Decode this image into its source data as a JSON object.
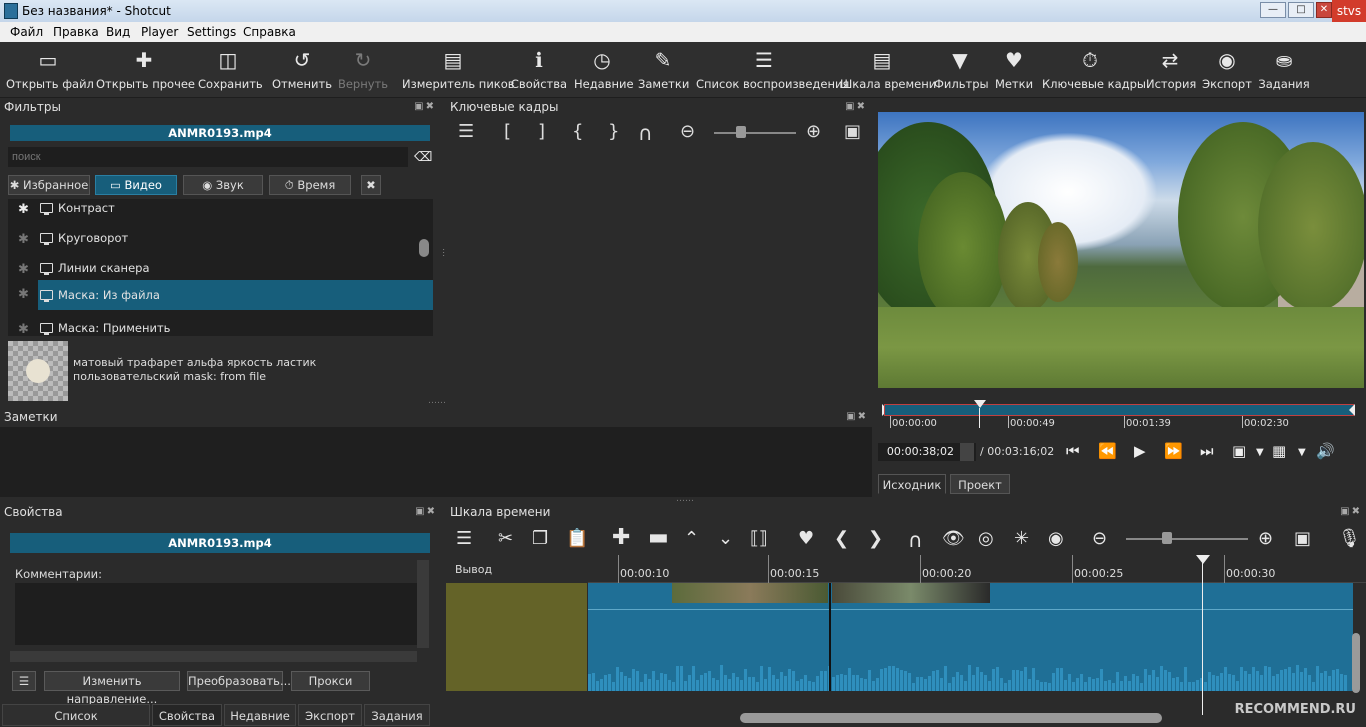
{
  "window": {
    "title": "Без названия* - Shotcut",
    "user_badge": "stvs"
  },
  "menu": [
    "Файл",
    "Правка",
    "Вид",
    "Player",
    "Settings",
    "Справка"
  ],
  "toolbar": [
    {
      "icon": "open-file-icon",
      "label": "Открыть файл"
    },
    {
      "icon": "open-other-icon",
      "label": "Открыть прочее"
    },
    {
      "icon": "save-icon",
      "label": "Сохранить"
    },
    {
      "icon": "undo-icon",
      "label": "Отменить"
    },
    {
      "icon": "redo-icon",
      "label": "Вернуть"
    },
    {
      "icon": "peak-meter-icon",
      "label": "Измеритель пиков"
    },
    {
      "icon": "properties-icon",
      "label": "Свойства"
    },
    {
      "icon": "recent-icon",
      "label": "Недавние"
    },
    {
      "icon": "notes-icon",
      "label": "Заметки"
    },
    {
      "icon": "playlist-icon",
      "label": "Список воспроизведения"
    },
    {
      "icon": "timeline-icon",
      "label": "Шкала времени"
    },
    {
      "icon": "filters-icon",
      "label": "Фильтры"
    },
    {
      "icon": "markers-icon",
      "label": "Метки"
    },
    {
      "icon": "keyframes-icon",
      "label": "Ключевые кадры"
    },
    {
      "icon": "history-icon",
      "label": "История"
    },
    {
      "icon": "export-icon",
      "label": "Экспорт"
    },
    {
      "icon": "jobs-icon",
      "label": "Задания"
    }
  ],
  "filters": {
    "title": "Фильтры",
    "file": "ANMR0193.mp4",
    "search_placeholder": "поиск",
    "tabs": [
      "Избранное",
      "Видео",
      "Звук",
      "Время"
    ],
    "items": [
      "Контраст",
      "Круговорот",
      "Линии сканера",
      "Маска: Из файла",
      "Маска: Применить"
    ],
    "description": "матовый трафарет альфа яркость ластик пользовательский mask: from file"
  },
  "keyframes": {
    "title": "Ключевые кадры"
  },
  "player": {
    "ticks": [
      "00:00:00",
      "00:00:49",
      "00:01:39",
      "00:02:30"
    ],
    "current": "00:00:38;02",
    "total": "/ 00:03:16;02",
    "tabs": [
      "Исходник",
      "Проект"
    ]
  },
  "notes": {
    "title": "Заметки"
  },
  "properties": {
    "title": "Свойства",
    "file": "ANMR0193.mp4",
    "comments_label": "Комментарии:",
    "buttons": [
      "Изменить направление...",
      "Преобразовать...",
      "Прокси"
    ]
  },
  "bottom_tabs": [
    "Список воспроизведения",
    "Свойства",
    "Недавние",
    "Экспорт",
    "Задания"
  ],
  "timeline": {
    "title": "Шкала времени",
    "track": "Вывод",
    "ticks": [
      "00:00:10",
      "00:00:15",
      "00:00:20",
      "00:00:25",
      "00:00:30"
    ]
  },
  "watermark": "RECOMMEND.RU"
}
